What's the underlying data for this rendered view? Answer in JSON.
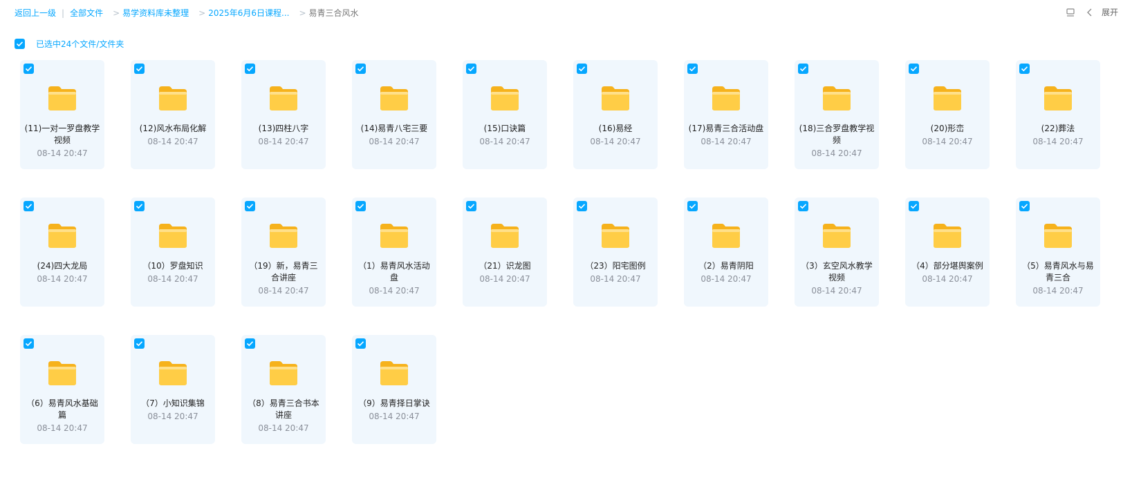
{
  "breadcrumb": {
    "back": "返回上一级",
    "items": [
      "全部文件",
      "易学资料库未整理",
      "2025年6月6日课程..."
    ],
    "current": "易青三合风水"
  },
  "toolbar": {
    "expand_label": "展开",
    "view_icon": "list-view-icon",
    "collapse_icon": "chevron-left-icon"
  },
  "selection": {
    "text": "已选中24个文件/文件夹",
    "checked": true
  },
  "colors": {
    "accent": "#06a7ff",
    "card_bg": "#f0f7fd",
    "folder": "#ffc93c"
  },
  "files": [
    {
      "name": "(11)一对一罗盘教学视频",
      "date": "08-14 20:47"
    },
    {
      "name": "(12)风水布局化解",
      "date": "08-14 20:47"
    },
    {
      "name": "(13)四柱八字",
      "date": "08-14 20:47"
    },
    {
      "name": "(14)易青八宅三要",
      "date": "08-14 20:47"
    },
    {
      "name": "(15)口诀篇",
      "date": "08-14 20:47"
    },
    {
      "name": "(16)易经",
      "date": "08-14 20:47"
    },
    {
      "name": "(17)易青三合活动盘",
      "date": "08-14 20:47"
    },
    {
      "name": "(18)三合罗盘教学视频",
      "date": "08-14 20:47"
    },
    {
      "name": "(20)形峦",
      "date": "08-14 20:47"
    },
    {
      "name": "(22)葬法",
      "date": "08-14 20:47"
    },
    {
      "name": "(24)四大龙局",
      "date": "08-14 20:47"
    },
    {
      "name": "（10）罗盘知识",
      "date": "08-14 20:47"
    },
    {
      "name": "（19）新，易青三合讲座",
      "date": "08-14 20:47"
    },
    {
      "name": "（1）易青风水活动盘",
      "date": "08-14 20:47"
    },
    {
      "name": "（21）识龙图",
      "date": "08-14 20:47"
    },
    {
      "name": "（23）阳宅图例",
      "date": "08-14 20:47"
    },
    {
      "name": "（2）易青阴阳",
      "date": "08-14 20:47"
    },
    {
      "name": "（3）玄空风水教学视频",
      "date": "08-14 20:47"
    },
    {
      "name": "（4）部分堪舆案例",
      "date": "08-14 20:47"
    },
    {
      "name": "（5）易青风水与易青三合",
      "date": "08-14 20:47"
    },
    {
      "name": "（6）易青风水基础篇",
      "date": "08-14 20:47"
    },
    {
      "name": "（7）小知识集锦",
      "date": "08-14 20:47"
    },
    {
      "name": "（8）易青三合书本讲座",
      "date": "08-14 20:47"
    },
    {
      "name": "（9）易青择日掌诀",
      "date": "08-14 20:47"
    }
  ]
}
